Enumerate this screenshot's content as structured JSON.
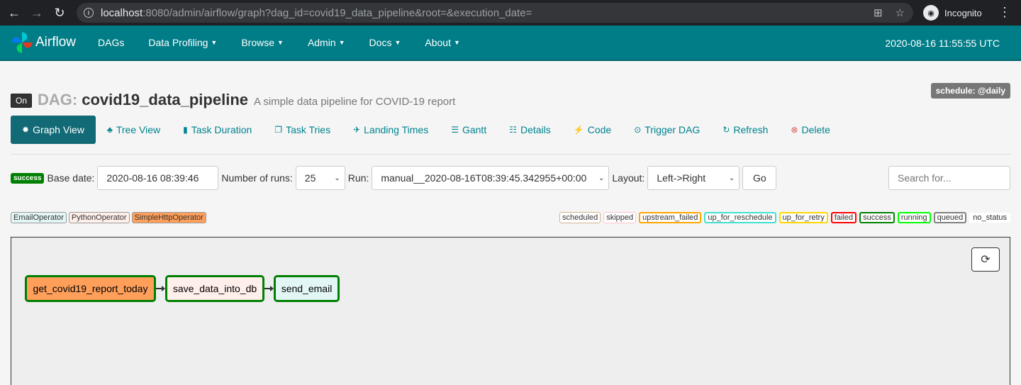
{
  "browser": {
    "url_host": "localhost",
    "url_rest": ":8080/admin/airflow/graph?dag_id=covid19_data_pipeline&root=&execution_date=",
    "profile_label": "Incognito"
  },
  "navbar": {
    "brand": "Airflow",
    "items": [
      {
        "label": "DAGs",
        "dropdown": false
      },
      {
        "label": "Data Profiling",
        "dropdown": true
      },
      {
        "label": "Browse",
        "dropdown": true
      },
      {
        "label": "Admin",
        "dropdown": true
      },
      {
        "label": "Docs",
        "dropdown": true
      },
      {
        "label": "About",
        "dropdown": true
      }
    ],
    "time": "2020-08-16 11:55:55 UTC",
    "color": "#017d87"
  },
  "dag": {
    "toggle": "On",
    "label": "DAG:",
    "id": "covid19_data_pipeline",
    "description": "A simple data pipeline for COVID-19 report",
    "schedule": "schedule: @daily"
  },
  "tabs": [
    {
      "label": "Graph View",
      "icon": "asterisk-icon",
      "glyph": "✹",
      "active": true
    },
    {
      "label": "Tree View",
      "icon": "tree-icon",
      "glyph": "♣",
      "active": false
    },
    {
      "label": "Task Duration",
      "icon": "bar-chart-icon",
      "glyph": "▮",
      "active": false
    },
    {
      "label": "Task Tries",
      "icon": "duplicate-icon",
      "glyph": "❐",
      "active": false
    },
    {
      "label": "Landing Times",
      "icon": "plane-icon",
      "glyph": "✈",
      "active": false
    },
    {
      "label": "Gantt",
      "icon": "align-left-icon",
      "glyph": "☰",
      "active": false
    },
    {
      "label": "Details",
      "icon": "list-icon",
      "glyph": "☷",
      "active": false
    },
    {
      "label": "Code",
      "icon": "flash-icon",
      "glyph": "⚡",
      "active": false
    },
    {
      "label": "Trigger DAG",
      "icon": "play-circle-icon",
      "glyph": "⊙",
      "active": false
    },
    {
      "label": "Refresh",
      "icon": "refresh-icon",
      "glyph": "↻",
      "active": false
    },
    {
      "label": "Delete",
      "icon": "remove-circle-icon",
      "glyph": "⊗",
      "active": false
    }
  ],
  "filters": {
    "status": "success",
    "base_date_label": "Base date:",
    "base_date": "2020-08-16 08:39:46",
    "num_runs_label": "Number of runs:",
    "num_runs": "25",
    "run_label": "Run:",
    "run": "manual__2020-08-16T08:39:45.342955+00:00",
    "layout_label": "Layout:",
    "layout": "Left->Right",
    "go": "Go",
    "search_placeholder": "Search for..."
  },
  "operators": [
    {
      "label": "EmailOperator",
      "color": "#e3f6f6"
    },
    {
      "label": "PythonOperator",
      "color": "#ffefeb"
    },
    {
      "label": "SimpleHttpOperator",
      "color": "#ff9f5a"
    }
  ],
  "states": [
    {
      "label": "scheduled",
      "color": "#d2b48c",
      "thick": false
    },
    {
      "label": "skipped",
      "color": "#ffc0cb",
      "thick": false
    },
    {
      "label": "upstream_failed",
      "color": "#ffa500",
      "thick": true
    },
    {
      "label": "up_for_reschedule",
      "color": "#40e0d0",
      "thick": true
    },
    {
      "label": "up_for_retry",
      "color": "#ffd700",
      "thick": true
    },
    {
      "label": "failed",
      "color": "#ff0000",
      "thick": true
    },
    {
      "label": "success",
      "color": "#008000",
      "thick": true
    },
    {
      "label": "running",
      "color": "#00ff00",
      "thick": true
    },
    {
      "label": "queued",
      "color": "#808080",
      "thick": true
    },
    {
      "label": "no_status",
      "color": "",
      "thick": false
    }
  ],
  "graph": {
    "nodes": [
      {
        "label": "get_covid19_report_today",
        "color": "#ff9f5a"
      },
      {
        "label": "save_data_into_db",
        "color": "#ffefeb"
      },
      {
        "label": "send_email",
        "color": "#e3f6f6"
      }
    ],
    "node_border": "#008000"
  }
}
